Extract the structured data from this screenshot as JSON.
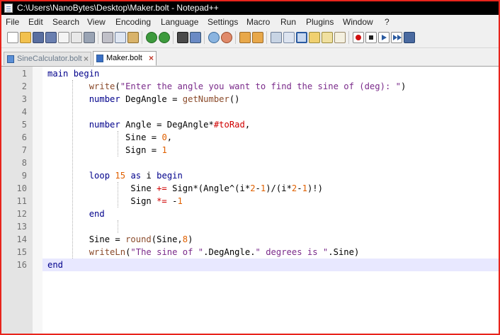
{
  "window": {
    "title": "C:\\Users\\NanoBytes\\Desktop\\Maker.bolt - Notepad++"
  },
  "menu": [
    "File",
    "Edit",
    "Search",
    "View",
    "Encoding",
    "Language",
    "Settings",
    "Macro",
    "Run",
    "Plugins",
    "Window",
    "?"
  ],
  "toolbar": {
    "buttons": [
      "new-file-icon",
      "open-file-icon",
      "save-icon",
      "save-all-icon",
      "close-icon",
      "close-all-icon",
      "print-icon",
      "cut-icon",
      "copy-icon",
      "paste-icon",
      "undo-icon",
      "redo-icon",
      "find-icon",
      "replace-icon",
      "zoom-in-icon",
      "zoom-out-icon",
      "sync-vertical-icon",
      "sync-horizontal-icon",
      "word-wrap-icon",
      "show-all-chars-icon",
      "indent-guide-icon",
      "user-language-icon",
      "doc-map-icon",
      "function-list-icon",
      "record-macro-icon",
      "stop-macro-icon",
      "play-macro-icon",
      "run-macro-multiple-icon",
      "save-macro-icon"
    ]
  },
  "tabs": [
    {
      "label": "SineCalculator.bolt",
      "close": "×",
      "active": false
    },
    {
      "label": "Maker.bolt",
      "close": "×",
      "active": true
    }
  ],
  "editor": {
    "current_line": 16,
    "line_numbers": [
      "1",
      "2",
      "3",
      "4",
      "5",
      "6",
      "7",
      "8",
      "9",
      "10",
      "11",
      "12",
      "13",
      "14",
      "15",
      "16"
    ],
    "lines": [
      "main begin",
      "        write(\"Enter the angle you want to find the sine of (deg): \")",
      "        number DegAngle = getNumber()",
      "",
      "        number Angle = DegAngle*#toRad,",
      "               Sine = 0,",
      "               Sign = 1",
      "",
      "        loop 15 as i begin",
      "                Sine += Sign*(Angle^(i*2-1)/(i*2-1)!)",
      "                Sign *= -1",
      "        end",
      "",
      "        Sine = round(Sine,8)",
      "        writeLn(\"The sine of \".DegAngle.\" degrees is \".Sine)",
      "end"
    ]
  }
}
